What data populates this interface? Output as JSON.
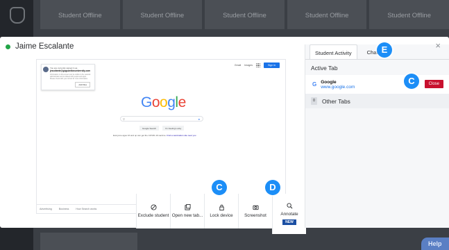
{
  "background": {
    "tiles": [
      "Student Offline",
      "Student Offline",
      "Student Offline",
      "Student Offline",
      "Student Offline"
    ],
    "help_label": "Help"
  },
  "modal": {
    "student_name": "Jaime Escalante",
    "close_symbol": "×",
    "status_color": "#22a447",
    "preview": {
      "popup_line1": "You are currently signed in as",
      "popup_email": "jescalante@goguardianuniversity.com",
      "popup_body": "Information on this screen can be visible to the network administrator and is shared with people and apps. Please check with your school for more information.",
      "popup_button": "Add Files",
      "top_links": [
        "Gmail",
        "Images"
      ],
      "sign_in": "Sign in",
      "logo_letters": [
        "G",
        "o",
        "o",
        "g",
        "l",
        "e"
      ],
      "buttons": [
        "Google Search",
        "I'm Feeling Lucky"
      ],
      "info_text": "Everyone ages 16 and up can get the COVID-19 vaccine.",
      "info_link": "Find a vaccination site near you",
      "footer_left": [
        "Advertising",
        "Business",
        "How Search works"
      ],
      "footer_mid": "Carbon neutral since 2007",
      "footer_right": "Privacy"
    },
    "toolbar": [
      {
        "label": "Exclude student",
        "icon": "ban-icon"
      },
      {
        "label": "Open new tab...",
        "icon": "new-tab-icon"
      },
      {
        "label": "Lock device",
        "icon": "lock-icon"
      },
      {
        "label": "Screenshot",
        "icon": "camera-icon"
      },
      {
        "label": "Annotate",
        "icon": "annotate-icon",
        "badge": "NEW"
      }
    ],
    "callouts": {
      "lock": "C",
      "screenshot": "D",
      "chat": "E",
      "close": "C"
    }
  },
  "panel": {
    "tabs": [
      "Student Activity",
      "Chat"
    ],
    "active_tab_heading": "Active Tab",
    "active_tab": {
      "title": "Google",
      "url": "www.google.com",
      "close_label": "Close"
    },
    "other_tabs": {
      "count": "0",
      "label": "Other Tabs"
    }
  },
  "colors": {
    "accent": "#1c8ef7",
    "danger": "#c8102e",
    "badge": "#1b4fa3"
  }
}
